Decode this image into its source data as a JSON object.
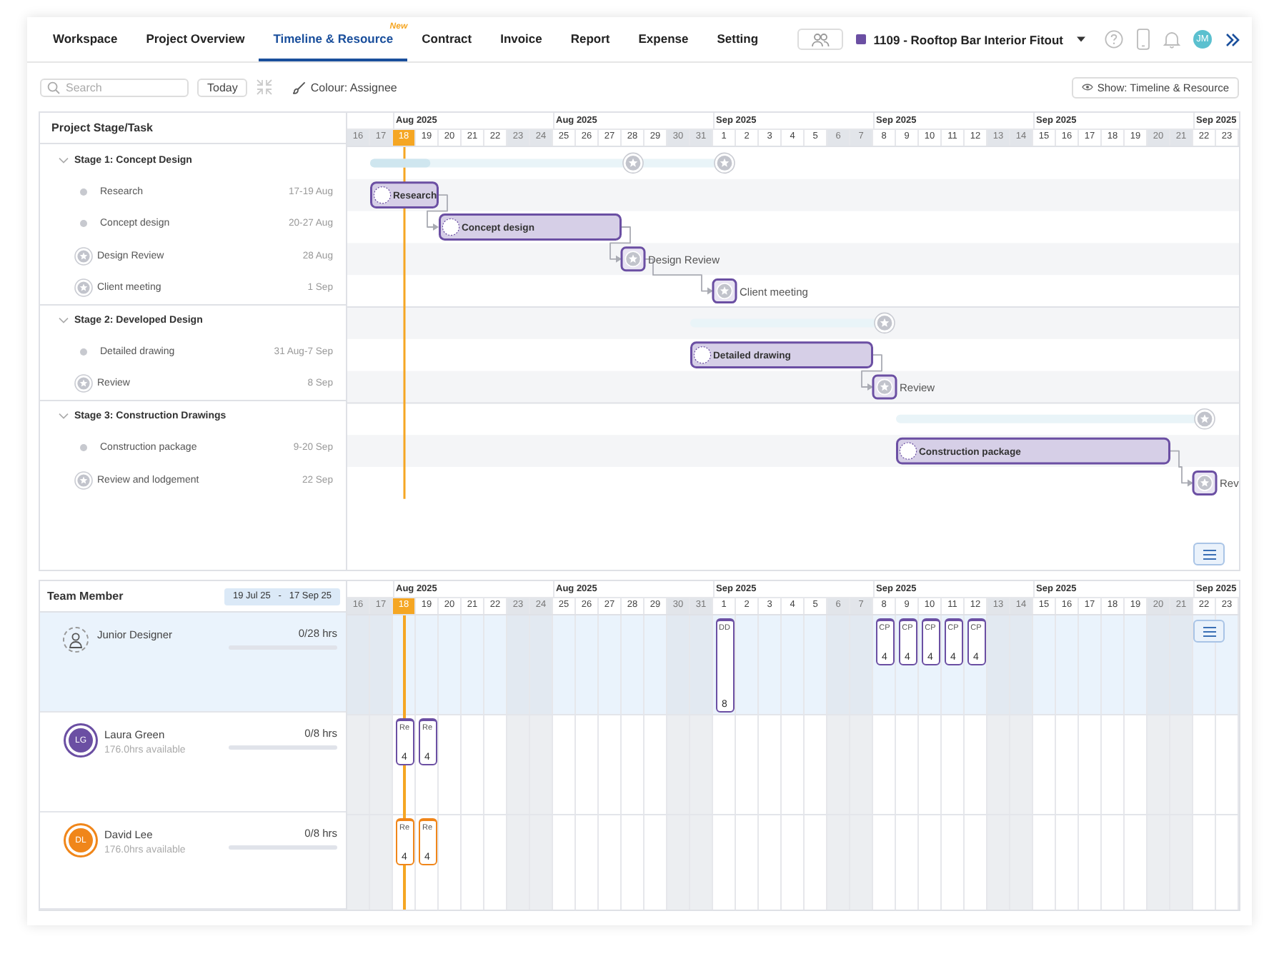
{
  "nav": {
    "tabs": [
      {
        "label": "Workspace",
        "selected": false
      },
      {
        "label": "Project Overview",
        "selected": false
      },
      {
        "label": "Timeline & Resource",
        "selected": true,
        "badge": "New"
      },
      {
        "label": "Contract",
        "selected": false
      },
      {
        "label": "Invoice",
        "selected": false
      },
      {
        "label": "Report",
        "selected": false
      },
      {
        "label": "Expense",
        "selected": false
      },
      {
        "label": "Setting",
        "selected": false
      }
    ],
    "project": "1109 - Rooftop Bar Interior Fitout",
    "user_initials": "JM"
  },
  "toolbar": {
    "search": {
      "placeholder": "Search"
    },
    "today_button": "Today",
    "colour_by": "Colour: Assignee",
    "show_button": "Show: Timeline & Resource"
  },
  "gantt": {
    "header": "Project Stage/Task",
    "timeline": {
      "days": [
        {
          "label": "16",
          "weekend": true,
          "today": false
        },
        {
          "label": "17",
          "weekend": true,
          "today": false
        },
        {
          "label": "18",
          "weekend": false,
          "today": true,
          "week_label": "Aug 2025"
        },
        {
          "label": "19",
          "weekend": false,
          "today": false
        },
        {
          "label": "20",
          "weekend": false,
          "today": false
        },
        {
          "label": "21",
          "weekend": false,
          "today": false
        },
        {
          "label": "22",
          "weekend": false,
          "today": false
        },
        {
          "label": "23",
          "weekend": true,
          "today": false
        },
        {
          "label": "24",
          "weekend": true,
          "today": false
        },
        {
          "label": "25",
          "weekend": false,
          "today": false,
          "week_label": "Aug 2025"
        },
        {
          "label": "26",
          "weekend": false,
          "today": false
        },
        {
          "label": "27",
          "weekend": false,
          "today": false
        },
        {
          "label": "28",
          "weekend": false,
          "today": false
        },
        {
          "label": "29",
          "weekend": false,
          "today": false
        },
        {
          "label": "30",
          "weekend": true,
          "today": false
        },
        {
          "label": "31",
          "weekend": true,
          "today": false
        },
        {
          "label": "1",
          "weekend": false,
          "today": false,
          "week_label": "Sep 2025"
        },
        {
          "label": "2",
          "weekend": false,
          "today": false
        },
        {
          "label": "3",
          "weekend": false,
          "today": false
        },
        {
          "label": "4",
          "weekend": false,
          "today": false
        },
        {
          "label": "5",
          "weekend": false,
          "today": false
        },
        {
          "label": "6",
          "weekend": true,
          "today": false
        },
        {
          "label": "7",
          "weekend": true,
          "today": false
        },
        {
          "label": "8",
          "weekend": false,
          "today": false,
          "week_label": "Sep 2025"
        },
        {
          "label": "9",
          "weekend": false,
          "today": false
        },
        {
          "label": "10",
          "weekend": false,
          "today": false
        },
        {
          "label": "11",
          "weekend": false,
          "today": false
        },
        {
          "label": "12",
          "weekend": false,
          "today": false
        },
        {
          "label": "13",
          "weekend": true,
          "today": false
        },
        {
          "label": "14",
          "weekend": true,
          "today": false
        },
        {
          "label": "15",
          "weekend": false,
          "today": false,
          "week_label": "Sep 2025"
        },
        {
          "label": "16",
          "weekend": false,
          "today": false
        },
        {
          "label": "17",
          "weekend": false,
          "today": false
        },
        {
          "label": "18",
          "weekend": false,
          "today": false
        },
        {
          "label": "19",
          "weekend": false,
          "today": false
        },
        {
          "label": "20",
          "weekend": true,
          "today": false
        },
        {
          "label": "21",
          "weekend": true,
          "today": false
        },
        {
          "label": "22",
          "weekend": false,
          "today": false,
          "week_label": "Sep 2025"
        },
        {
          "label": "23",
          "weekend": false,
          "today": false
        }
      ]
    },
    "stages": [
      {
        "name": "Stage 1: Concept Design",
        "expanded": true,
        "level": 0.17,
        "tasks": [
          {
            "kind": "task",
            "name": "Research",
            "dates": "17-19 Aug",
            "bar_label": "Research",
            "linked": false
          },
          {
            "kind": "task",
            "name": "Concept design",
            "dates": "20-27 Aug",
            "bar_label": "Concept design",
            "linked": true
          },
          {
            "kind": "milestone",
            "name": "Design Review",
            "dates": "28 Aug",
            "bar_label": "Design Review",
            "linked": true
          },
          {
            "kind": "milestone",
            "name": "Client meeting",
            "dates": "1 Sep",
            "bar_label": "Client meeting",
            "linked": true
          }
        ]
      },
      {
        "name": "Stage 2: Developed Design",
        "expanded": true,
        "tasks": [
          {
            "kind": "task",
            "name": "Detailed drawing",
            "dates": "31 Aug-7 Sep",
            "bar_label": "Detailed drawing",
            "linked": false
          },
          {
            "kind": "milestone",
            "name": "Review",
            "dates": "8 Sep",
            "bar_label": "Review",
            "linked": true
          }
        ]
      },
      {
        "name": "Stage 3: Construction Drawings",
        "expanded": true,
        "tasks": [
          {
            "kind": "task",
            "name": "Construction package",
            "dates": "9-20 Sep",
            "bar_label": "Construction package",
            "linked": false
          },
          {
            "kind": "milestone",
            "name": "Review and lodgement",
            "dates": "22 Sep",
            "bar_label": "Rev",
            "linked": true
          }
        ]
      }
    ]
  },
  "resources": {
    "header": "Team Member",
    "range_from": "19 Jul 25",
    "range_sep": "-",
    "range_to": "17 Sep 25",
    "timeline": {
      "days": [
        {
          "label": "16",
          "weekend": true,
          "today": false
        },
        {
          "label": "17",
          "weekend": true,
          "today": false
        },
        {
          "label": "18",
          "weekend": false,
          "today": true,
          "week_label": "Aug 2025"
        },
        {
          "label": "19",
          "weekend": false,
          "today": false
        },
        {
          "label": "20",
          "weekend": false,
          "today": false
        },
        {
          "label": "21",
          "weekend": false,
          "today": false
        },
        {
          "label": "22",
          "weekend": false,
          "today": false
        },
        {
          "label": "23",
          "weekend": true,
          "today": false
        },
        {
          "label": "24",
          "weekend": true,
          "today": false
        },
        {
          "label": "25",
          "weekend": false,
          "today": false,
          "week_label": "Aug 2025"
        },
        {
          "label": "26",
          "weekend": false,
          "today": false
        },
        {
          "label": "27",
          "weekend": false,
          "today": false
        },
        {
          "label": "28",
          "weekend": false,
          "today": false
        },
        {
          "label": "29",
          "weekend": false,
          "today": false
        },
        {
          "label": "30",
          "weekend": true,
          "today": false
        },
        {
          "label": "31",
          "weekend": true,
          "today": false
        },
        {
          "label": "1",
          "weekend": false,
          "today": false,
          "week_label": "Sep 2025"
        },
        {
          "label": "2",
          "weekend": false,
          "today": false
        },
        {
          "label": "3",
          "weekend": false,
          "today": false
        },
        {
          "label": "4",
          "weekend": false,
          "today": false
        },
        {
          "label": "5",
          "weekend": false,
          "today": false
        },
        {
          "label": "6",
          "weekend": true,
          "today": false
        },
        {
          "label": "7",
          "weekend": true,
          "today": false
        },
        {
          "label": "8",
          "weekend": false,
          "today": false,
          "week_label": "Sep 2025"
        },
        {
          "label": "9",
          "weekend": false,
          "today": false
        },
        {
          "label": "10",
          "weekend": false,
          "today": false
        },
        {
          "label": "11",
          "weekend": false,
          "today": false
        },
        {
          "label": "12",
          "weekend": false,
          "today": false
        },
        {
          "label": "13",
          "weekend": true,
          "today": false
        },
        {
          "label": "14",
          "weekend": true,
          "today": false
        },
        {
          "label": "15",
          "weekend": false,
          "today": false,
          "week_label": "Sep 2025"
        },
        {
          "label": "16",
          "weekend": false,
          "today": false
        },
        {
          "label": "17",
          "weekend": false,
          "today": false
        },
        {
          "label": "18",
          "weekend": false,
          "today": false
        },
        {
          "label": "19",
          "weekend": false,
          "today": false
        },
        {
          "label": "20",
          "weekend": true,
          "today": false
        },
        {
          "label": "21",
          "weekend": true,
          "today": false
        },
        {
          "label": "22",
          "weekend": false,
          "today": false,
          "week_label": "Sep 2025"
        },
        {
          "label": "23",
          "weekend": false,
          "today": false
        }
      ]
    },
    "members": [
      {
        "kind": "placeholder",
        "name": "Junior Designer",
        "hours": "0/28 hrs",
        "level": 0,
        "selected": true,
        "color": "#6b4fa3",
        "allocations": [
          {
            "kind": "full_day",
            "code": "DD",
            "hours": "8"
          },
          {
            "kind": "half_day",
            "code": "CP",
            "hours": "4"
          },
          {
            "kind": "half_day",
            "code": "CP",
            "hours": "4"
          },
          {
            "kind": "half_day",
            "code": "CP",
            "hours": "4"
          },
          {
            "kind": "half_day",
            "code": "CP",
            "hours": "4"
          },
          {
            "kind": "half_day",
            "code": "CP",
            "hours": "4"
          }
        ]
      },
      {
        "kind": "person",
        "name": "Laura Green",
        "initials": "LG",
        "availability": "176.0hrs available",
        "hours": "0/8 hrs",
        "level": 0,
        "selected": false,
        "color": "#6b4fa3",
        "allocations": [
          {
            "kind": "half_day",
            "code": "Re",
            "hours": "4"
          },
          {
            "kind": "half_day",
            "code": "Re",
            "hours": "4"
          }
        ]
      },
      {
        "kind": "person",
        "name": "David Lee",
        "initials": "DL",
        "availability": "176.0hrs available",
        "hours": "0/8 hrs",
        "level": 0,
        "selected": false,
        "color": "#f0861a",
        "allocations": [
          {
            "kind": "half_day",
            "code": "Re",
            "hours": "4"
          },
          {
            "kind": "half_day",
            "code": "Re",
            "hours": "4"
          }
        ]
      }
    ]
  }
}
